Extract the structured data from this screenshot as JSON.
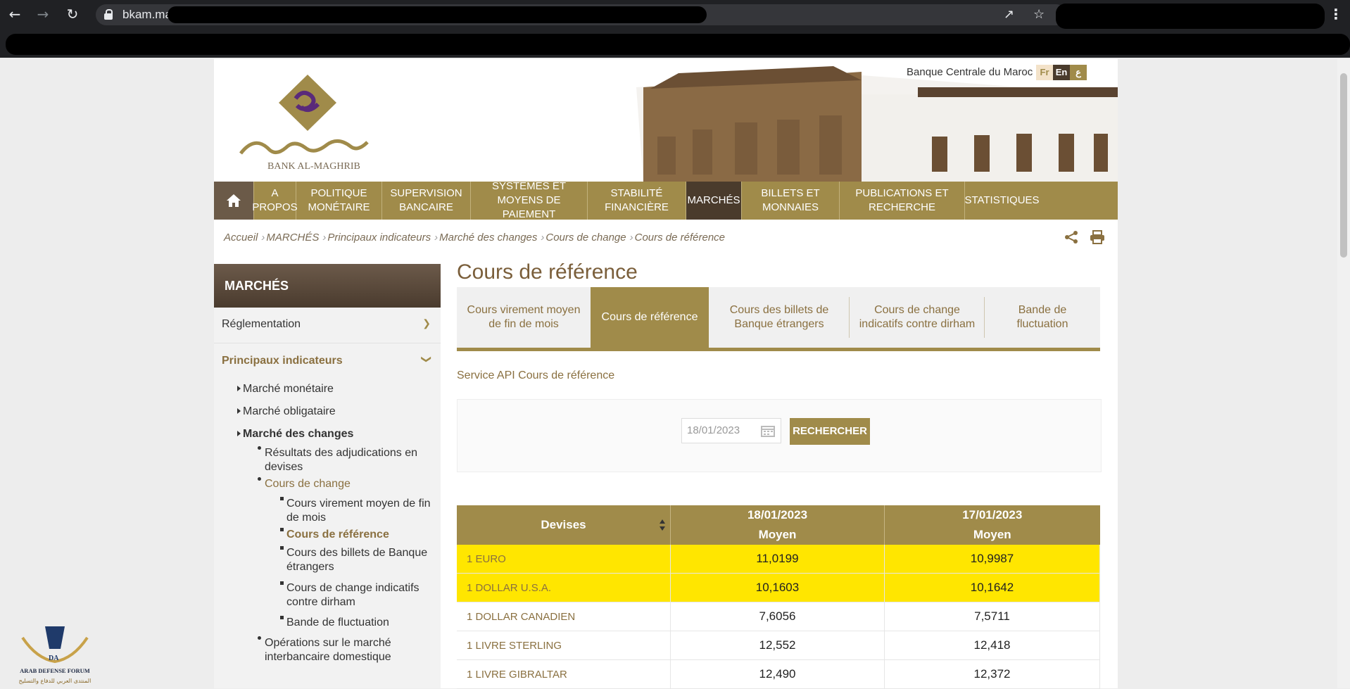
{
  "browser": {
    "url_host": "bkam.ma",
    "icons": [
      "back-icon",
      "forward-icon",
      "reload-icon",
      "lock-icon",
      "share-icon",
      "star-icon",
      "menu-icon"
    ]
  },
  "header": {
    "bank_name": "Banque Centrale du Maroc",
    "logo_text": "BANK AL-MAGHRIB",
    "languages": [
      "Fr",
      "En",
      "ع"
    ],
    "colors": {
      "brand_gold": "#a08b4a",
      "brand_brown": "#4a3b2c",
      "highlight": "#ffe600"
    }
  },
  "menu": {
    "items": [
      {
        "label": "A PROPOS"
      },
      {
        "label": "POLITIQUE MONÉTAIRE"
      },
      {
        "label": "SUPERVISION BANCAIRE"
      },
      {
        "label": "SYSTÈMES ET MOYENS DE PAIEMENT"
      },
      {
        "label": "STABILITÉ FINANCIÈRE"
      },
      {
        "label": "MARCHÉS"
      },
      {
        "label": "BILLETS ET MONNAIES"
      },
      {
        "label": "PUBLICATIONS ET RECHERCHE"
      },
      {
        "label": "STATISTIQUES"
      }
    ]
  },
  "breadcrumb": [
    "Accueil",
    "MARCHÉS",
    "Principaux indicateurs",
    "Marché des changes",
    "Cours de change",
    "Cours de référence"
  ],
  "sidebar": {
    "title": "MARCHÉS",
    "reglementation": "Réglementation",
    "principaux": "Principaux indicateurs",
    "marche_monetaire": "Marché monétaire",
    "marche_obligataire": "Marché obligataire",
    "marche_changes": "Marché des changes",
    "resultats": "Résultats des adjudications en devises",
    "cours_change": "Cours de change",
    "cours_virement": "Cours virement moyen de fin de mois",
    "cours_reference": "Cours de référence",
    "cours_billets": "Cours des billets de Banque étrangers",
    "cours_indicatifs": "Cours de change indicatifs contre dirham",
    "bande": "Bande de fluctuation",
    "operations": "Opérations sur le marché interbancaire domestique"
  },
  "main": {
    "title": "Cours de référence",
    "tabs": [
      {
        "label": "Cours virement moyen de fin de mois"
      },
      {
        "label": "Cours de référence"
      },
      {
        "label": "Cours des billets de Banque étrangers"
      },
      {
        "label": "Cours de change indicatifs contre dirham"
      },
      {
        "label": "Bande de fluctuation"
      }
    ],
    "api_link": "Service API Cours de référence",
    "search": {
      "date_value": "18/01/2023",
      "button": "RECHERCHER"
    },
    "table": {
      "col_devises": "Devises",
      "date1": "18/01/2023",
      "date2": "17/01/2023",
      "sub": "Moyen",
      "rows": [
        {
          "name": "1 EURO",
          "v1": "11,0199",
          "v2": "10,9987"
        },
        {
          "name": "1 DOLLAR U.S.A.",
          "v1": "10,1603",
          "v2": "10,1642"
        },
        {
          "name": "1 DOLLAR CANADIEN",
          "v1": "7,6056",
          "v2": "7,5711"
        },
        {
          "name": "1 LIVRE STERLING",
          "v1": "12,552",
          "v2": "12,418"
        },
        {
          "name": "1 LIVRE GIBRALTAR",
          "v1": "12,490",
          "v2": "12,372"
        }
      ]
    }
  },
  "watermark": {
    "line1": "ARAB DEFENSE FORUM",
    "line2": "المنتدى العربي للدفاع والتسليح"
  }
}
